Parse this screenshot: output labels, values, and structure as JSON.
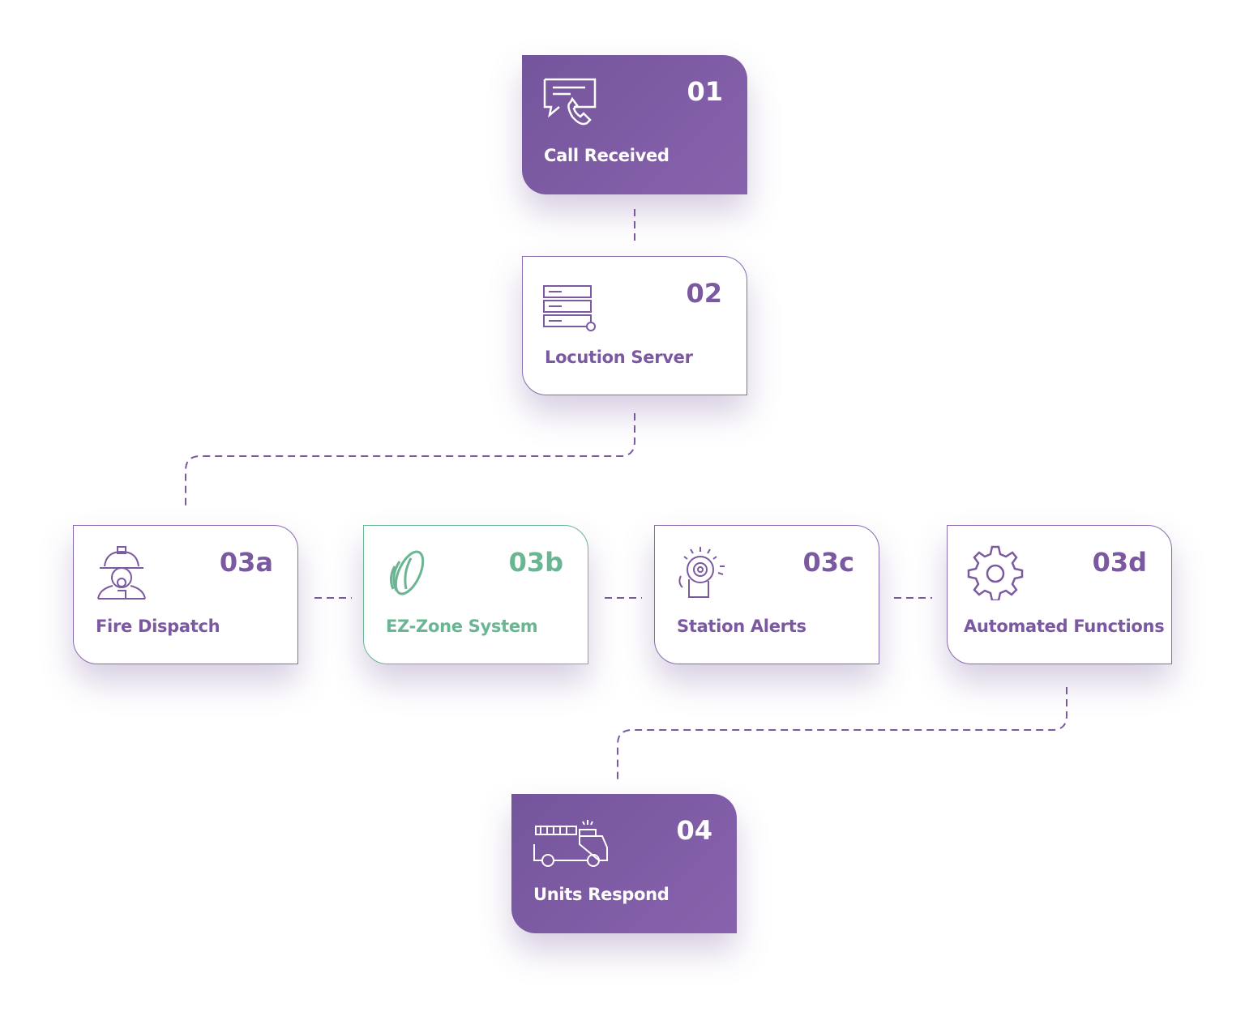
{
  "colors": {
    "purple": "#7b5aa0",
    "green": "#6ab592"
  },
  "steps": [
    {
      "num": "01",
      "label": "Call Received",
      "icon": "chat-phone-icon"
    },
    {
      "num": "02",
      "label": "Locution Server",
      "icon": "server-icon"
    },
    {
      "num": "03a",
      "label": "Fire Dispatch",
      "icon": "firefighter-icon"
    },
    {
      "num": "03b",
      "label": "EZ-Zone System",
      "icon": "ez-zone-logo-icon"
    },
    {
      "num": "03c",
      "label": "Station Alerts",
      "icon": "alarm-bell-icon"
    },
    {
      "num": "03d",
      "label": "Automated Functions",
      "icon": "gear-icon"
    },
    {
      "num": "04",
      "label": "Units Respond",
      "icon": "fire-truck-icon"
    }
  ]
}
